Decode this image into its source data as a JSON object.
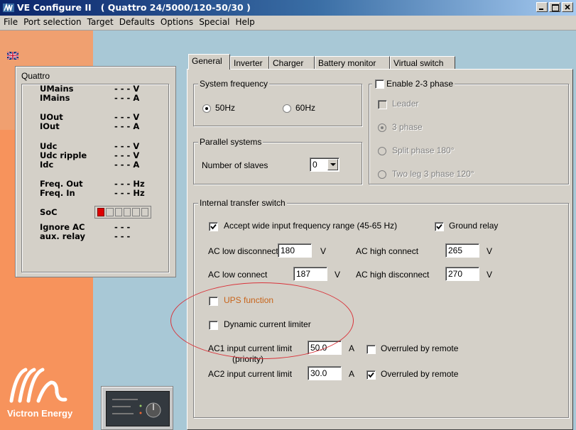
{
  "window": {
    "app_name": "VE Configure II",
    "title_suffix": "( Quattro 24/5000/120-50/30 )"
  },
  "menu": [
    "File",
    "Port selection",
    "Target",
    "Defaults",
    "Options",
    "Special",
    "Help"
  ],
  "device_panel": {
    "title": "Quattro",
    "rows": [
      {
        "label": "UMains",
        "value": "- - - V"
      },
      {
        "label": "IMains",
        "value": "- - - A"
      },
      {
        "label": "UOut",
        "value": "- - - V"
      },
      {
        "label": "IOut",
        "value": "- - - A"
      },
      {
        "label": "Udc",
        "value": "- - - V"
      },
      {
        "label": "Udc ripple",
        "value": "- - - V"
      },
      {
        "label": "Idc",
        "value": "- - - A"
      },
      {
        "label": "Freq. Out",
        "value": "- - - Hz"
      },
      {
        "label": "Freq. In",
        "value": "- - - Hz"
      },
      {
        "label": "SoC",
        "value": ""
      },
      {
        "label": "Ignore AC",
        "value": "- - -"
      },
      {
        "label": "aux. relay",
        "value": "- - -"
      }
    ],
    "soc_segments_on": 1,
    "soc_segments_total": 6
  },
  "branding": {
    "logo_text": "Victron Energy"
  },
  "tabs": [
    "General",
    "Inverter",
    "Charger",
    "Battery monitor",
    "Virtual switch"
  ],
  "active_tab": "General",
  "general": {
    "system_frequency": {
      "title": "System frequency",
      "option_50": "50Hz",
      "option_60": "60Hz",
      "selected": "50Hz"
    },
    "parallel": {
      "title": "Parallel systems",
      "slaves_label": "Number of slaves",
      "slaves_value": "0"
    },
    "phase": {
      "enable_label": "Enable 2-3 phase",
      "enabled": false,
      "leader_label": "Leader",
      "opt_3phase": "3 phase",
      "opt_split": "Split phase 180°",
      "opt_twoleg": "Two leg 3 phase 120°"
    },
    "transfer": {
      "title": "Internal transfer switch",
      "wide_freq_label": "Accept wide input frequency range (45-65 Hz)",
      "wide_freq_checked": true,
      "ground_relay_label": "Ground relay",
      "ground_relay_checked": true,
      "ac_low_disconnect_label": "AC low disconnect",
      "ac_low_disconnect_value": "180",
      "ac_high_connect_label": "AC high connect",
      "ac_high_connect_value": "265",
      "ac_low_connect_label": "AC low connect",
      "ac_low_connect_value": "187",
      "ac_high_disconnect_label": "AC high disconnect",
      "ac_high_disconnect_value": "270",
      "unit_v": "V",
      "ups_label": "UPS function",
      "ups_checked": false,
      "dyn_limiter_label": "Dynamic current limiter",
      "dyn_limiter_checked": false,
      "ac1_label": "AC1 input current limit",
      "ac1_sub": "(priority)",
      "ac1_value": "50.0",
      "ac1_overrule_label": "Overruled by remote",
      "ac1_overrule_checked": false,
      "ac2_label": "AC2 input current limit",
      "ac2_value": "30.0",
      "ac2_overrule_label": "Overruled by remote",
      "ac2_overrule_checked": true,
      "unit_a": "A"
    }
  },
  "colors": {
    "title_bar": "#0a246a",
    "highlight_ellipse": "#d9333a",
    "ups_label": "#c8641a",
    "left_strip": "#f7935c"
  }
}
